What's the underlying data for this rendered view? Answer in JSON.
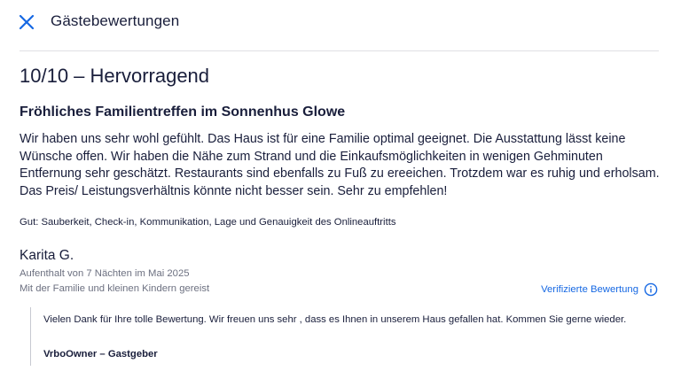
{
  "header": {
    "title": "Gästebewertungen",
    "close_icon": "close-icon"
  },
  "review": {
    "rating_text": "10/10 – Hervorragend",
    "title": "Fröhliches Familientreffen im Sonnenhus Glowe",
    "body": "Wir haben uns sehr wohl gefühlt. Das Haus ist für eine Familie optimal geeignet. Die Ausstattung lässt keine Wünsche offen. Wir haben die Nähe zum Strand und die Einkaufsmöglichkeiten in wenigen Gehminuten Entfernung sehr geschätzt. Restaurants sind ebenfalls zu Fuß zu ereeichen. Trotzdem war es ruhig und erholsam. Das Preis/ Leistungsverhältnis könnte nicht besser sein. Sehr zu empfehlen!",
    "good_line": "Gut: Sauberkeit, Check-in, Kommunikation, Lage und Genauigkeit des Onlineauftritts"
  },
  "author": {
    "name": "Karita G.",
    "stay": "Aufenthalt von 7 Nächten im Mai 2025",
    "travel_type": "Mit der Familie und kleinen Kindern gereist",
    "verified_label": "Verifizierte Bewertung",
    "verified_icon": "info-icon"
  },
  "reply": {
    "text": "Vielen Dank für Ihre tolle Bewertung. Wir freuen uns sehr , dass es Ihnen in unserem Haus gefallen hat. Kommen Sie gerne wieder.",
    "author": "VrboOwner – Gastgeber"
  },
  "colors": {
    "text": "#191e3b",
    "secondary_text": "#6c7080",
    "accent": "#1668e3",
    "divider": "#dfe0e4"
  }
}
